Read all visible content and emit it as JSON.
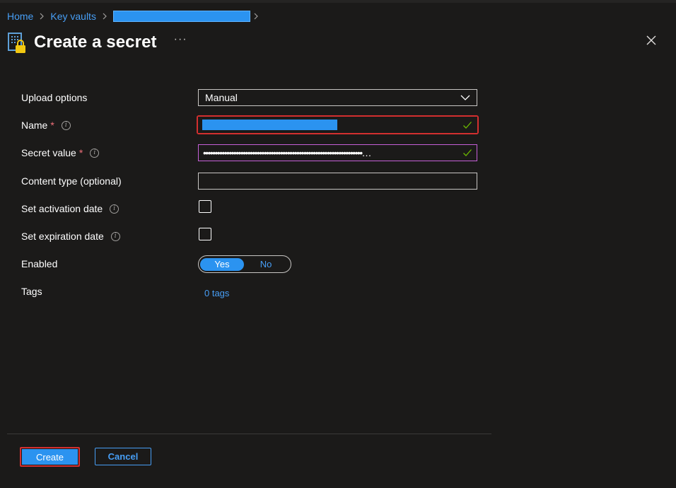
{
  "breadcrumb": {
    "home": "Home",
    "key_vaults": "Key vaults"
  },
  "header": {
    "title": "Create a secret",
    "more": "···"
  },
  "form": {
    "upload_options": {
      "label": "Upload options",
      "value": "Manual"
    },
    "name": {
      "label": "Name",
      "required_mark": "*",
      "info": "i"
    },
    "secret_value": {
      "label": "Secret value",
      "required_mark": "*",
      "info": "i",
      "masked": "••••••••••••••••••••••••••••••••••••••••••••••••••••••••••••••••••••…"
    },
    "content_type": {
      "label": "Content type (optional)",
      "value": ""
    },
    "activation_date": {
      "label": "Set activation date",
      "info": "i",
      "checked": false
    },
    "expiration_date": {
      "label": "Set expiration date",
      "info": "i",
      "checked": false
    },
    "enabled": {
      "label": "Enabled",
      "yes": "Yes",
      "no": "No",
      "selected": "Yes"
    },
    "tags": {
      "label": "Tags",
      "link": "0 tags"
    }
  },
  "footer": {
    "create": "Create",
    "cancel": "Cancel"
  },
  "colors": {
    "background": "#1b1a19",
    "accent": "#2b93f0",
    "link": "#479ef5",
    "highlight_outline": "#d32f2f",
    "valid_check": "#6bb700"
  }
}
